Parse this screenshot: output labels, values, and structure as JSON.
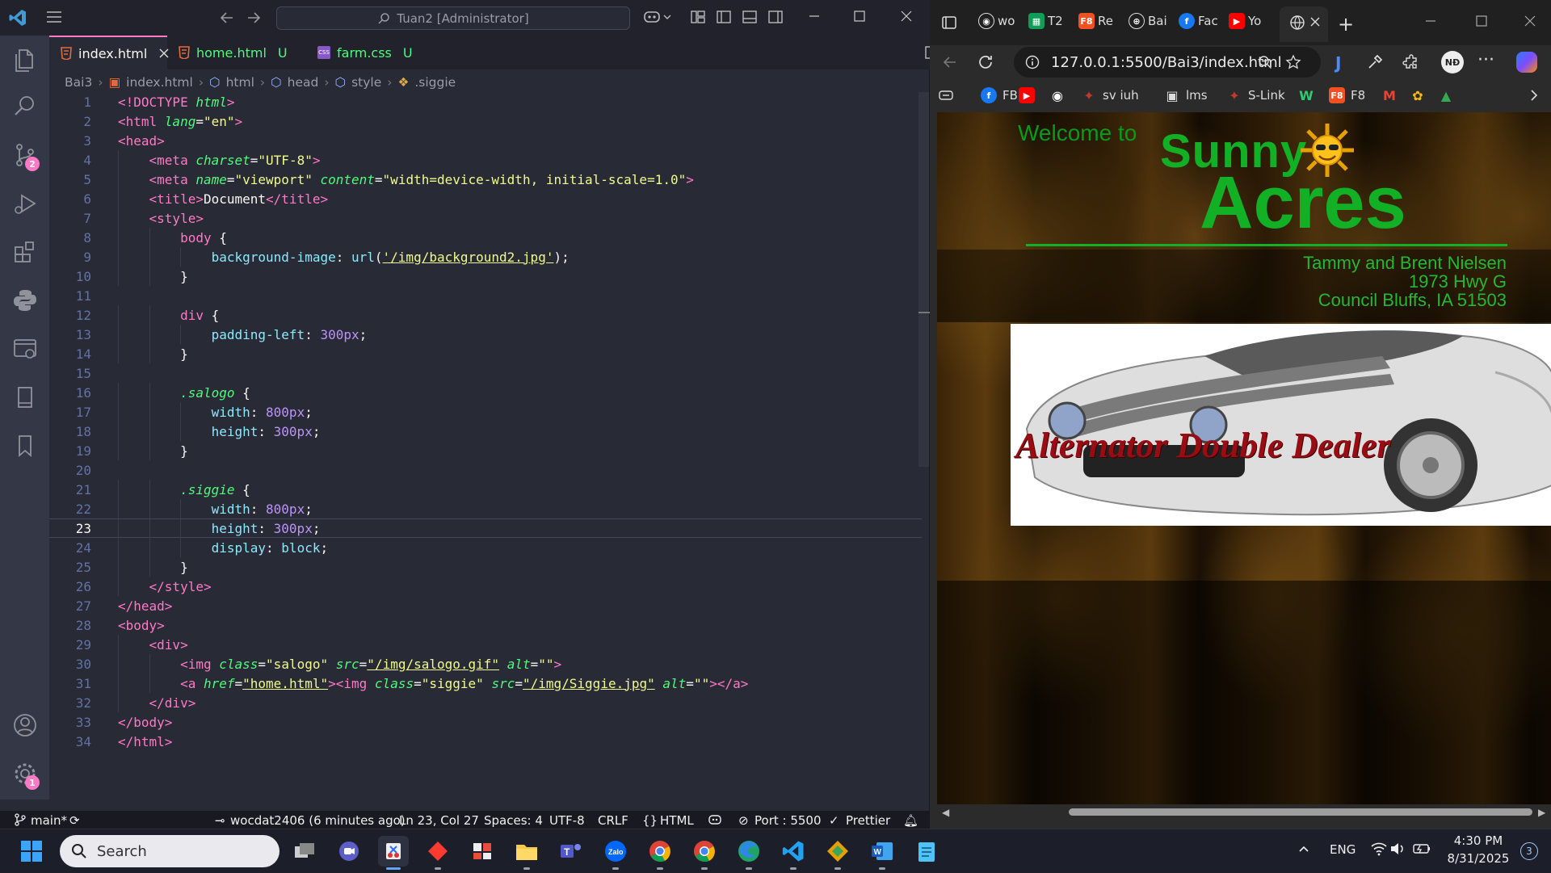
{
  "vscode": {
    "title_search": "Tuan2 [Administrator]",
    "tabs": [
      {
        "label": "index.html",
        "modified": "",
        "active": true
      },
      {
        "label": "home.html",
        "modified": "U",
        "active": false
      },
      {
        "label": "farm.css",
        "modified": "U",
        "active": false
      }
    ],
    "breadcrumb": [
      "Bai3",
      "index.html",
      "html",
      "head",
      "style",
      ".siggie"
    ],
    "activity_badges": {
      "scm": "2",
      "settings": "1"
    },
    "current_line": 23,
    "code": [
      [
        [
          "tg",
          "<!DOCTYPE "
        ],
        [
          "at",
          "html"
        ],
        [
          "tg",
          ">"
        ]
      ],
      [
        [
          "tg",
          "<html "
        ],
        [
          "at",
          "lang"
        ],
        [
          "pl",
          "="
        ],
        [
          "st",
          "\"en\""
        ],
        [
          "tg",
          ">"
        ]
      ],
      [
        [
          "tg",
          "<head>"
        ]
      ],
      [
        [
          "pl",
          "    "
        ],
        [
          "tg",
          "<meta "
        ],
        [
          "at",
          "charset"
        ],
        [
          "pl",
          "="
        ],
        [
          "st",
          "\"UTF-8\""
        ],
        [
          "tg",
          ">"
        ]
      ],
      [
        [
          "pl",
          "    "
        ],
        [
          "tg",
          "<meta "
        ],
        [
          "at",
          "name"
        ],
        [
          "pl",
          "="
        ],
        [
          "st",
          "\"viewport\""
        ],
        [
          "pl",
          " "
        ],
        [
          "at",
          "content"
        ],
        [
          "pl",
          "="
        ],
        [
          "st",
          "\"width=device-width, initial-scale=1.0\""
        ],
        [
          "tg",
          ">"
        ]
      ],
      [
        [
          "pl",
          "    "
        ],
        [
          "tg",
          "<title>"
        ],
        [
          "pl",
          "Document"
        ],
        [
          "tg",
          "</title>"
        ]
      ],
      [
        [
          "pl",
          "    "
        ],
        [
          "tg",
          "<style>"
        ]
      ],
      [
        [
          "pl",
          "        "
        ],
        [
          "tg",
          "body"
        ],
        [
          "pl",
          " {"
        ]
      ],
      [
        [
          "pl",
          "            "
        ],
        [
          "pr",
          "background-image"
        ],
        [
          "pl",
          ": "
        ],
        [
          "pr",
          "url"
        ],
        [
          "pl",
          "("
        ],
        [
          "st",
          "'/img/background2.jpg'"
        ],
        [
          "pl",
          ");"
        ]
      ],
      [
        [
          "pl",
          "        }"
        ]
      ],
      [
        [
          "pl",
          ""
        ]
      ],
      [
        [
          "pl",
          "        "
        ],
        [
          "tg",
          "div"
        ],
        [
          "pl",
          " {"
        ]
      ],
      [
        [
          "pl",
          "            "
        ],
        [
          "pr",
          "padding-left"
        ],
        [
          "pl",
          ": "
        ],
        [
          "nu",
          "300px"
        ],
        [
          "pl",
          ";"
        ]
      ],
      [
        [
          "pl",
          "        }"
        ]
      ],
      [
        [
          "pl",
          ""
        ]
      ],
      [
        [
          "pl",
          "        "
        ],
        [
          "cl",
          ".salogo"
        ],
        [
          "pl",
          " {"
        ]
      ],
      [
        [
          "pl",
          "            "
        ],
        [
          "pr",
          "width"
        ],
        [
          "pl",
          ": "
        ],
        [
          "nu",
          "800px"
        ],
        [
          "pl",
          ";"
        ]
      ],
      [
        [
          "pl",
          "            "
        ],
        [
          "pr",
          "height"
        ],
        [
          "pl",
          ": "
        ],
        [
          "nu",
          "300px"
        ],
        [
          "pl",
          ";"
        ]
      ],
      [
        [
          "pl",
          "        }"
        ]
      ],
      [
        [
          "pl",
          ""
        ]
      ],
      [
        [
          "pl",
          "        "
        ],
        [
          "cl",
          ".siggie"
        ],
        [
          "pl",
          " {"
        ]
      ],
      [
        [
          "pl",
          "            "
        ],
        [
          "pr",
          "width"
        ],
        [
          "pl",
          ": "
        ],
        [
          "nu",
          "800px"
        ],
        [
          "pl",
          ";"
        ]
      ],
      [
        [
          "pl",
          "            "
        ],
        [
          "pr",
          "height"
        ],
        [
          "pl",
          ": "
        ],
        [
          "nu",
          "300px"
        ],
        [
          "pl",
          ";"
        ]
      ],
      [
        [
          "pl",
          "            "
        ],
        [
          "pr",
          "display"
        ],
        [
          "pl",
          ": "
        ],
        [
          "pr",
          "block"
        ],
        [
          "pl",
          ";"
        ]
      ],
      [
        [
          "pl",
          "        }"
        ]
      ],
      [
        [
          "pl",
          "    "
        ],
        [
          "tg",
          "</style>"
        ]
      ],
      [
        [
          "tg",
          "</head>"
        ]
      ],
      [
        [
          "tg",
          "<body>"
        ]
      ],
      [
        [
          "pl",
          "    "
        ],
        [
          "tg",
          "<div>"
        ]
      ],
      [
        [
          "pl",
          "        "
        ],
        [
          "tg",
          "<img "
        ],
        [
          "at",
          "class"
        ],
        [
          "pl",
          "="
        ],
        [
          "st",
          "\"salogo\""
        ],
        [
          "pl",
          " "
        ],
        [
          "at",
          "src"
        ],
        [
          "pl",
          "="
        ],
        [
          "st",
          "\"/img/salogo.gif\""
        ],
        [
          "pl",
          " "
        ],
        [
          "at",
          "alt"
        ],
        [
          "pl",
          "="
        ],
        [
          "st",
          "\"\""
        ],
        [
          "tg",
          ">"
        ]
      ],
      [
        [
          "pl",
          "        "
        ],
        [
          "tg",
          "<a "
        ],
        [
          "at",
          "href"
        ],
        [
          "pl",
          "="
        ],
        [
          "st",
          "\"home.html\""
        ],
        [
          "tg",
          ">"
        ],
        [
          "tg",
          "<img "
        ],
        [
          "at",
          "class"
        ],
        [
          "pl",
          "="
        ],
        [
          "st",
          "\"siggie\""
        ],
        [
          "pl",
          " "
        ],
        [
          "at",
          "src"
        ],
        [
          "pl",
          "="
        ],
        [
          "st",
          "\"/img/Siggie.jpg\""
        ],
        [
          "pl",
          " "
        ],
        [
          "at",
          "alt"
        ],
        [
          "pl",
          "="
        ],
        [
          "st",
          "\"\""
        ],
        [
          "tg",
          "></a>"
        ]
      ],
      [
        [
          "pl",
          "    "
        ],
        [
          "tg",
          "</div>"
        ]
      ],
      [
        [
          "tg",
          "</body>"
        ]
      ],
      [
        [
          "tg",
          "</html>"
        ]
      ]
    ],
    "status": {
      "branch": "main*",
      "commit": "wocdat2406 (6 minutes ago)",
      "cursor": "Ln 23, Col 27",
      "spaces": "Spaces: 4",
      "encoding": "UTF-8",
      "eol": "CRLF",
      "language": "HTML",
      "port": "Port : 5500",
      "prettier": "Prettier"
    }
  },
  "browser": {
    "tabs": [
      {
        "label": "wo",
        "icon": "github-icon"
      },
      {
        "label": "T2",
        "icon": "sheets-icon"
      },
      {
        "label": "Re",
        "icon": "f8-icon"
      },
      {
        "label": "Bai",
        "icon": "globe-icon"
      },
      {
        "label": "Fac",
        "icon": "facebook-icon"
      },
      {
        "label": "Yo",
        "icon": "youtube-icon"
      }
    ],
    "url": "127.0.0.1:5500/Bai3/index.html",
    "profile": "NĐ",
    "bookmarks": [
      {
        "label": "FB",
        "icon": "facebook-icon",
        "color": "#1877f2"
      },
      {
        "label": "",
        "icon": "youtube-icon",
        "color": "#ff0000"
      },
      {
        "label": "",
        "icon": "github-icon",
        "color": "#ffffff"
      },
      {
        "label": "sv iuh",
        "icon": "iuh-icon",
        "color": "#c0392b"
      },
      {
        "label": "lms",
        "icon": "lms-icon",
        "color": "#dddddd"
      },
      {
        "label": "S-Link",
        "icon": "slink-icon",
        "color": "#c0392b"
      },
      {
        "label": "",
        "icon": "w-icon",
        "color": "#2ecc71"
      },
      {
        "label": "F8",
        "icon": "f8-icon",
        "color": "#f05123"
      },
      {
        "label": "",
        "icon": "gmail-icon",
        "color": "#ea4335"
      },
      {
        "label": "",
        "icon": "photos-icon",
        "color": "#fbbc05"
      },
      {
        "label": "",
        "icon": "drive-icon",
        "color": "#34a853"
      }
    ],
    "page": {
      "welcome": "Welcome to",
      "sunny": "Sunny",
      "acres": "Acres",
      "owner": "Tammy and Brent Nielsen",
      "street": "1973 Hwy G",
      "city": "Council Bluffs, IA  51503",
      "banner": "Alternator Double Dealer"
    }
  },
  "taskbar": {
    "search": "Search",
    "lang": "ENG",
    "time": "4:30 PM",
    "date": "8/31/2025",
    "notif": "3"
  }
}
